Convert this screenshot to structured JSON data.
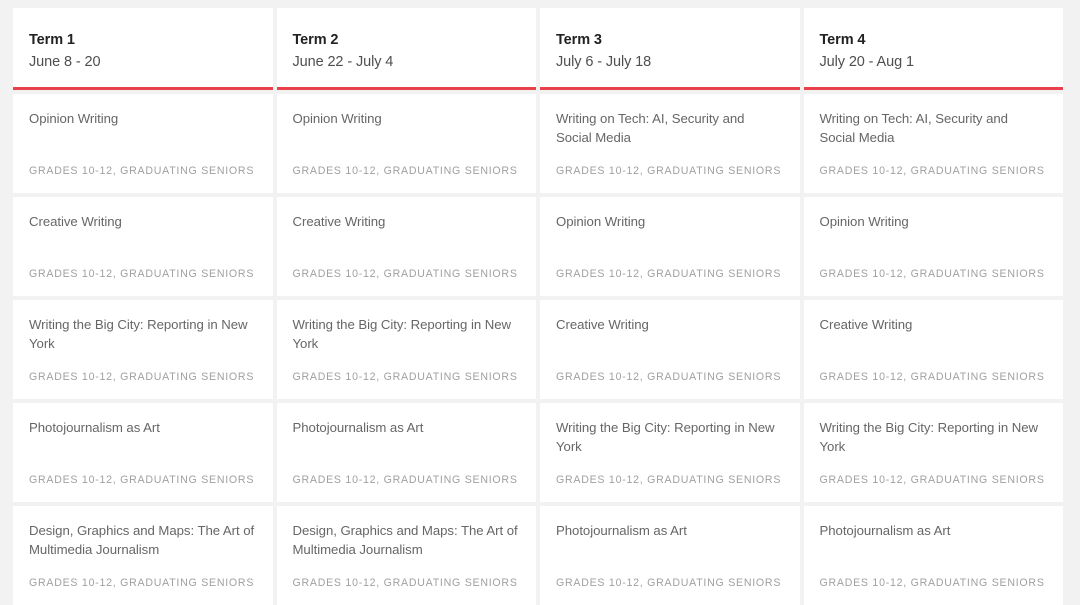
{
  "theme": {
    "page_background": "#f2f2f2",
    "card_background": "#ffffff",
    "accent_rule": "#e8414a",
    "term_name_color": "#222222",
    "term_date_color": "#4f4f4f",
    "course_title_color": "#666666",
    "grades_label_color": "#a0a0a0"
  },
  "grades_label": "GRADES 10-12, GRADUATING SENIORS",
  "columns": [
    {
      "term": "Term 1",
      "dates": "June 8 - 20",
      "courses": [
        {
          "title": "Opinion Writing",
          "grades": "GRADES 10-12, GRADUATING SENIORS"
        },
        {
          "title": "Creative Writing",
          "grades": "GRADES 10-12, GRADUATING SENIORS"
        },
        {
          "title": "Writing the Big City: Reporting in New York",
          "grades": "GRADES 10-12, GRADUATING SENIORS"
        },
        {
          "title": "Photojournalism as Art",
          "grades": "GRADES 10-12, GRADUATING SENIORS"
        },
        {
          "title": "Design, Graphics and Maps: The Art of Multimedia Journalism",
          "grades": "GRADES 10-12, GRADUATING SENIORS"
        }
      ]
    },
    {
      "term": "Term 2",
      "dates": "June 22 - July 4",
      "courses": [
        {
          "title": "Opinion Writing",
          "grades": "GRADES 10-12, GRADUATING SENIORS"
        },
        {
          "title": "Creative Writing",
          "grades": "GRADES 10-12, GRADUATING SENIORS"
        },
        {
          "title": "Writing the Big City: Reporting in New York",
          "grades": "GRADES 10-12, GRADUATING SENIORS"
        },
        {
          "title": "Photojournalism as Art",
          "grades": "GRADES 10-12, GRADUATING SENIORS"
        },
        {
          "title": "Design, Graphics and Maps: The Art of Multimedia Journalism",
          "grades": "GRADES 10-12, GRADUATING SENIORS"
        }
      ]
    },
    {
      "term": "Term 3",
      "dates": "July 6 - July 18",
      "courses": [
        {
          "title": "Writing on Tech: AI, Security and Social Media",
          "grades": "GRADES 10-12, GRADUATING SENIORS"
        },
        {
          "title": "Opinion Writing",
          "grades": "GRADES 10-12, GRADUATING SENIORS"
        },
        {
          "title": "Creative Writing",
          "grades": "GRADES 10-12, GRADUATING SENIORS"
        },
        {
          "title": "Writing the Big City: Reporting in New York",
          "grades": "GRADES 10-12, GRADUATING SENIORS"
        },
        {
          "title": "Photojournalism as Art",
          "grades": "GRADES 10-12, GRADUATING SENIORS"
        }
      ]
    },
    {
      "term": "Term 4",
      "dates": "July 20 - Aug 1",
      "courses": [
        {
          "title": "Writing on Tech: AI, Security and Social Media",
          "grades": "GRADES 10-12, GRADUATING SENIORS"
        },
        {
          "title": "Opinion Writing",
          "grades": "GRADES 10-12, GRADUATING SENIORS"
        },
        {
          "title": "Creative Writing",
          "grades": "GRADES 10-12, GRADUATING SENIORS"
        },
        {
          "title": "Writing the Big City: Reporting in New York",
          "grades": "GRADES 10-12, GRADUATING SENIORS"
        },
        {
          "title": "Photojournalism as Art",
          "grades": "GRADES 10-12, GRADUATING SENIORS"
        }
      ]
    }
  ]
}
